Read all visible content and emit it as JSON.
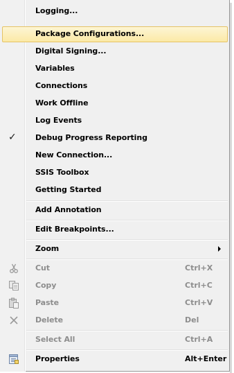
{
  "menu": {
    "items": [
      {
        "label": "Logging..."
      },
      {
        "label": "Package Configurations..."
      },
      {
        "label": "Digital Signing..."
      },
      {
        "label": "Variables"
      },
      {
        "label": "Connections"
      },
      {
        "label": "Work Offline"
      },
      {
        "label": "Log Events"
      },
      {
        "label": "Debug Progress Reporting",
        "checked": true
      },
      {
        "label": "New Connection..."
      },
      {
        "label": "SSIS Toolbox"
      },
      {
        "label": "Getting Started"
      },
      {
        "label": "Add Annotation"
      },
      {
        "label": "Edit Breakpoints..."
      },
      {
        "label": "Zoom"
      },
      {
        "label": "Cut",
        "shortcut": "Ctrl+X",
        "icon": "scissors-icon",
        "disabled": true
      },
      {
        "label": "Copy",
        "shortcut": "Ctrl+C",
        "icon": "copy-icon",
        "disabled": true
      },
      {
        "label": "Paste",
        "shortcut": "Ctrl+V",
        "icon": "paste-icon",
        "disabled": true
      },
      {
        "label": "Delete",
        "shortcut": "Del",
        "icon": "delete-icon",
        "disabled": true
      },
      {
        "label": "Select All",
        "shortcut": "Ctrl+A",
        "disabled": true
      },
      {
        "label": "Properties",
        "shortcut": "Alt+Enter",
        "icon": "properties-icon"
      }
    ],
    "check_glyph": "✓",
    "colors": {
      "highlight_border": "#e5c365",
      "highlight_fill": "#fbe9a6",
      "disabled_text": "#8d8d8d"
    }
  }
}
